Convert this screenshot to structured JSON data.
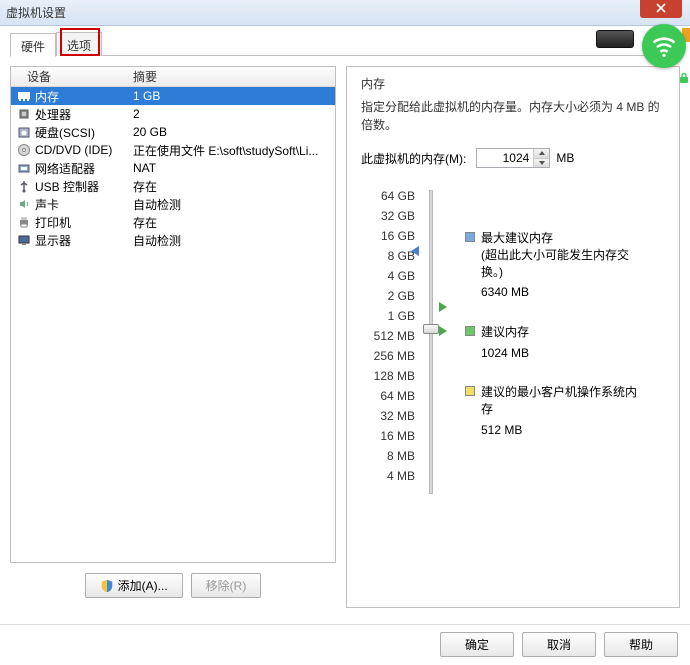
{
  "window": {
    "title": "虚拟机设置"
  },
  "tabs": {
    "hardware": "硬件",
    "options": "选项"
  },
  "table": {
    "head": {
      "device": "设备",
      "summary": "摘要"
    },
    "rows": [
      {
        "icon": "memory",
        "name": "内存",
        "summary": "1 GB",
        "selected": true
      },
      {
        "icon": "cpu",
        "name": "处理器",
        "summary": "2"
      },
      {
        "icon": "disk",
        "name": "硬盘(SCSI)",
        "summary": "20 GB"
      },
      {
        "icon": "cd",
        "name": "CD/DVD (IDE)",
        "summary": "正在使用文件 E:\\soft\\studySoft\\Li..."
      },
      {
        "icon": "net",
        "name": "网络适配器",
        "summary": "NAT"
      },
      {
        "icon": "usb",
        "name": "USB 控制器",
        "summary": "存在"
      },
      {
        "icon": "sound",
        "name": "声卡",
        "summary": "自动检测"
      },
      {
        "icon": "printer",
        "name": "打印机",
        "summary": "存在"
      },
      {
        "icon": "display",
        "name": "显示器",
        "summary": "自动检测"
      }
    ]
  },
  "leftButtons": {
    "add": "添加(A)...",
    "remove": "移除(R)"
  },
  "memory": {
    "group": "内存",
    "desc": "指定分配给此虚拟机的内存量。内存大小必须为 4 MB 的倍数。",
    "inputLabel": "此虚拟机的内存(M):",
    "value": "1024",
    "unit": "MB",
    "ticks": [
      "64 GB",
      "32 GB",
      "16 GB",
      "8 GB",
      "4 GB",
      "2 GB",
      "1 GB",
      "512 MB",
      "256 MB",
      "128 MB",
      "64 MB",
      "32 MB",
      "16 MB",
      "8 MB",
      "4 MB"
    ],
    "max": {
      "title": "最大建议内存",
      "note": "(超出此大小可能发生内存交换。)",
      "value": "6340 MB"
    },
    "rec": {
      "title": "建议内存",
      "value": "1024 MB"
    },
    "min": {
      "title": "建议的最小客户机操作系统内存",
      "value": "512 MB"
    }
  },
  "footer": {
    "ok": "确定",
    "cancel": "取消",
    "help": "帮助"
  }
}
